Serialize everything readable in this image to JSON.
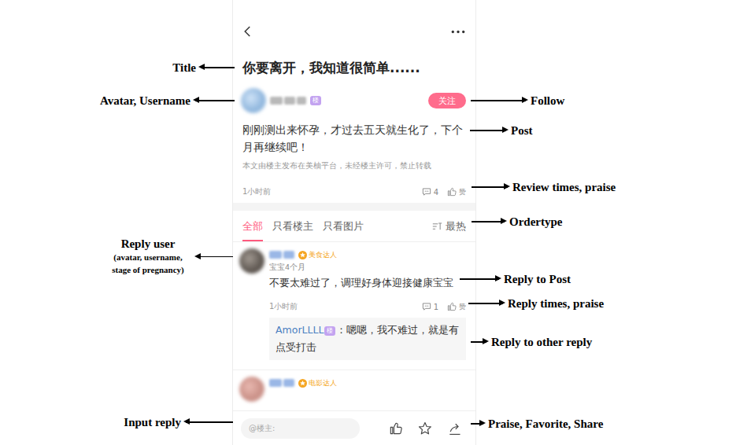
{
  "post": {
    "title": "你要离开，我知道很简单......",
    "author_badge": "楼",
    "follow": "关注",
    "body": "刚刚测出来怀孕，才过去五天就生化了，下个月再继续吧！",
    "notice": "本文由楼主发布在美柚平台，未经楼主许可，禁止转载",
    "time": "1小时前",
    "comments": "4",
    "praise": "赞"
  },
  "filters": {
    "tabs": [
      {
        "label": "全部",
        "selected": true
      },
      {
        "label": "只看楼主",
        "selected": false
      },
      {
        "label": "只看图片",
        "selected": false
      }
    ],
    "sort": "最热"
  },
  "replies": [
    {
      "badge": "美食达人",
      "stage": "宝宝4个月",
      "text": "不要太难过了，调理好身体迎接健康宝宝",
      "time": "1小时前",
      "comments": "1",
      "praise": "赞",
      "sub_replies": [
        {
          "user": "AmorLLLL",
          "badge": "楼",
          "text": "：嗯嗯，我不难过，就是有点受打击"
        }
      ]
    },
    {
      "badge": "电影达人"
    }
  ],
  "input": {
    "placeholder": "@楼主:"
  },
  "annotations": [
    {
      "label": "Title",
      "kind": "left"
    },
    {
      "label": "Avatar, Username",
      "kind": "left"
    },
    {
      "label": "Reply user",
      "note": "(avatar, username, stage of pregnancy)",
      "kind": "left"
    },
    {
      "label": "Input reply",
      "kind": "left"
    },
    {
      "label": "Follow",
      "kind": "right"
    },
    {
      "label": "Post",
      "kind": "right"
    },
    {
      "label": "Review times, praise",
      "kind": "right"
    },
    {
      "label": "Ordertype",
      "kind": "right"
    },
    {
      "label": "Reply to Post",
      "kind": "right"
    },
    {
      "label": "Reply times, praise",
      "kind": "right"
    },
    {
      "label": "Reply to other reply",
      "kind": "right"
    },
    {
      "label": "Praise, Favorite, Share",
      "kind": "right"
    }
  ]
}
